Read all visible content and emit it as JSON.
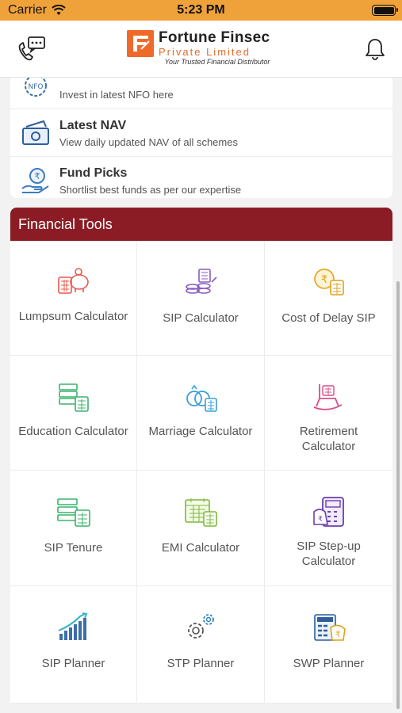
{
  "status_bar": {
    "carrier": "Carrier",
    "time": "5:23 PM"
  },
  "header": {
    "logo_title": "Fortune Finsec",
    "logo_subtitle": "Private Limited",
    "logo_tagline": "Your Trusted Financial Distributor",
    "left_icon": "call-chat-icon",
    "right_icon": "bell-icon"
  },
  "list": [
    {
      "title": "",
      "subtitle": "Invest in latest NFO here",
      "icon": "nfo-icon"
    },
    {
      "title": "Latest NAV",
      "subtitle": "View daily updated NAV of all schemes",
      "icon": "nav-icon"
    },
    {
      "title": "Fund Picks",
      "subtitle": "Shortlist best funds as per our expertise",
      "icon": "fund-picks-icon"
    }
  ],
  "tools_section": {
    "title": "Financial Tools",
    "tools": [
      {
        "label": "Lumpsum Calculator",
        "icon": "piggy-calculator-icon"
      },
      {
        "label": "SIP Calculator",
        "icon": "coins-calculator-icon"
      },
      {
        "label": "Cost of Delay SIP",
        "icon": "rupee-coin-calculator-icon"
      },
      {
        "label": "Education Calculator",
        "icon": "education-calculator-icon"
      },
      {
        "label": "Marriage Calculator",
        "icon": "rings-calculator-icon"
      },
      {
        "label": "Retirement Calculator",
        "icon": "rocking-chair-calculator-icon"
      },
      {
        "label": "SIP Tenure",
        "icon": "tenure-calculator-icon"
      },
      {
        "label": "EMI Calculator",
        "icon": "calendar-calculator-icon"
      },
      {
        "label": "SIP Step-up Calculator",
        "icon": "stepup-calculator-icon"
      },
      {
        "label": "SIP Planner",
        "icon": "bar-growth-icon"
      },
      {
        "label": "STP Planner",
        "icon": "gears-icon"
      },
      {
        "label": "SWP Planner",
        "icon": "rupee-bag-calculator-icon"
      }
    ]
  },
  "colors": {
    "status_bar": "#f0a23a",
    "tools_header": "#8b1c25",
    "logo_orange": "#ef6a2a"
  }
}
